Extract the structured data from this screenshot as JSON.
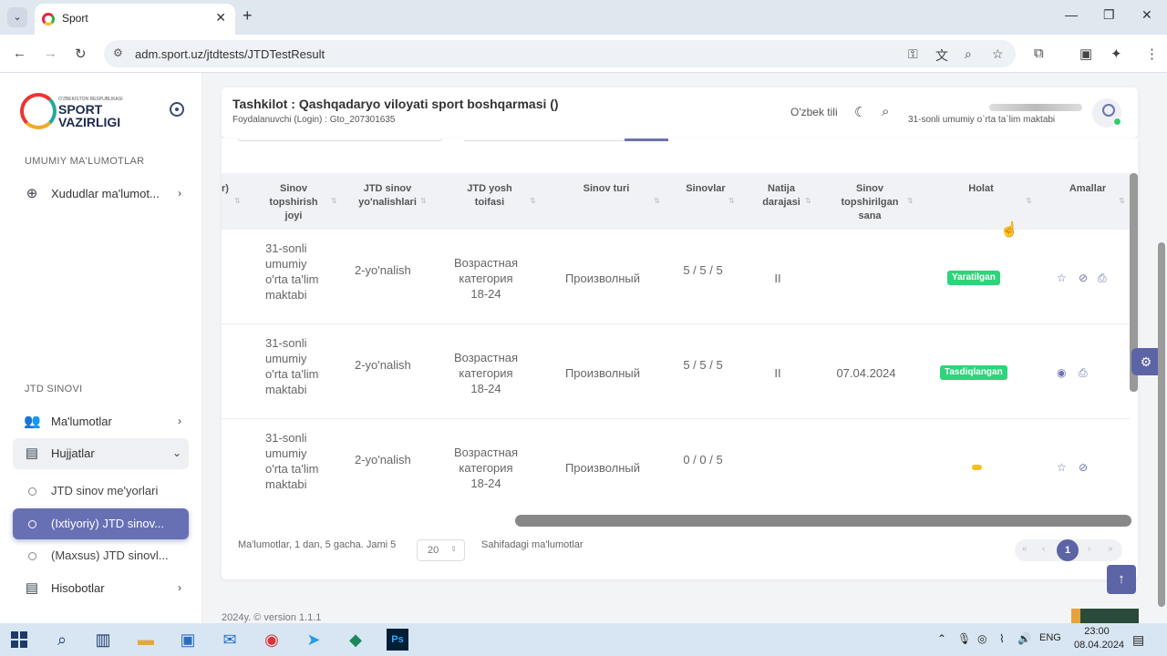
{
  "browser": {
    "tab_title": "Sport",
    "url": "adm.sport.uz/jtdtests/JTDTestResult"
  },
  "sidebar": {
    "logo_small": "O'ZBEKISTON RESPUBLIKASI",
    "logo_line1": "SPORT",
    "logo_line2": "VAZIRLIGI",
    "section1": "UMUMIY MA'LUMOTLAR",
    "item_regions": "Xududlar ma'lumot...",
    "section2": "JTD SINOVI",
    "item_info": "Ma'lumotlar",
    "item_docs": "Hujjatlar",
    "sub_norms": "JTD sinov me'yorlari",
    "sub_optional": "(Ixtiyoriy) JTD sinov...",
    "sub_special": "(Maxsus) JTD sinovl...",
    "item_reports": "Hisobotlar"
  },
  "header": {
    "org": "Tashkilot : Qashqadaryo viloyati sport boshqarmasi ()",
    "login": "Foydalanuvchi (Login) : Gto_207301635",
    "language": "O'zbek tili",
    "school": "31-sonli umumiy o`rta ta`lim maktabi"
  },
  "table": {
    "columns": {
      "c0": "r)",
      "place": "Sinov topshirish joyi",
      "direction": "JTD sinov yo'nalishlari",
      "age": "JTD yosh toifasi",
      "type": "Sinov turi",
      "tests": "Sinovlar",
      "level": "Natija darajasi",
      "date": "Sinov topshirilgan sana",
      "status": "Holat",
      "actions": "Amallar"
    },
    "rows": [
      {
        "place": "31-sonli umumiy o'rta ta'lim maktabi",
        "direction": "2-yo'nalish",
        "age": "Возрастная категория 18-24",
        "type": "Произволный",
        "tests": "5 / 5 / 5",
        "level": "II",
        "date": "",
        "status": "Yaratilgan"
      },
      {
        "place": "31-sonli umumiy o'rta ta'lim maktabi",
        "direction": "2-yo'nalish",
        "age": "Возрастная категория 18-24",
        "type": "Произволный",
        "tests": "5 / 5 / 5",
        "level": "II",
        "date": "07.04.2024",
        "status": "Tasdiqlangan"
      },
      {
        "place": "31-sonli umumiy o'rta ta'lim maktabi",
        "direction": "2-yo'nalish",
        "age": "Возрастная категория 18-24",
        "type": "Произволный",
        "tests": "0 / 0 / 5",
        "level": "",
        "date": "",
        "status": ""
      }
    ]
  },
  "footer": {
    "info": "Ma'lumotlar, 1 dan, 5 gacha. Jami 5",
    "per_page": "20",
    "per_page_label": "Sahifadagi ma'lumotlar",
    "current_page": "1",
    "copyright": "2024y. © version 1.1.1"
  },
  "taskbar": {
    "lang": "ENG",
    "time": "23:00",
    "date": "08.04.2024"
  },
  "colors": {
    "accent": "#5c64a6",
    "success": "#2ed47a",
    "warning": "#f2c21b"
  }
}
